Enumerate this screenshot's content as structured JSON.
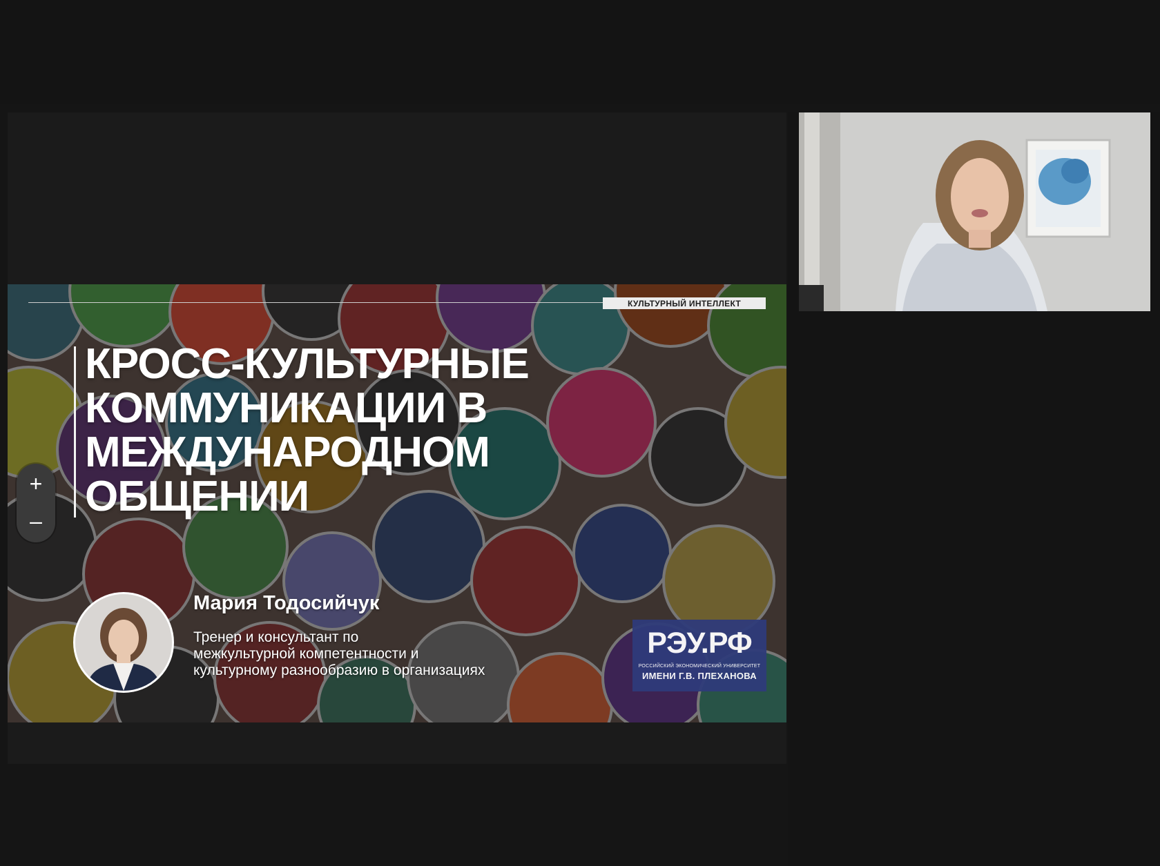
{
  "slide": {
    "tag": "КУЛЬТУРНЫЙ ИНТЕЛЛЕКТ",
    "title_lines": [
      "КРОСС-КУЛЬТУРНЫЕ",
      "КОММУНИКАЦИИ В",
      "МЕЖДУНАРОДНОМ",
      "ОБЩЕНИИ"
    ],
    "presenter": {
      "name": "Мария Тодосийчук",
      "description_lines": [
        "Тренер и консультант по",
        "межкультурной компетентности и",
        "культурному разнообразию в организациях"
      ]
    },
    "logo": {
      "main": "РЭУ.РФ",
      "sub1": "РОССИЙСКИЙ ЭКОНОМИЧЕСКИЙ УНИВЕРСИТЕТ",
      "sub2": "ИМЕНИ Г.В. ПЛЕХАНОВА"
    }
  },
  "zoom": {
    "plus": "+",
    "minus": "–"
  },
  "colors": {
    "background": "#151515",
    "logo_blue": "#2f3b7a",
    "text": "#ffffff"
  }
}
